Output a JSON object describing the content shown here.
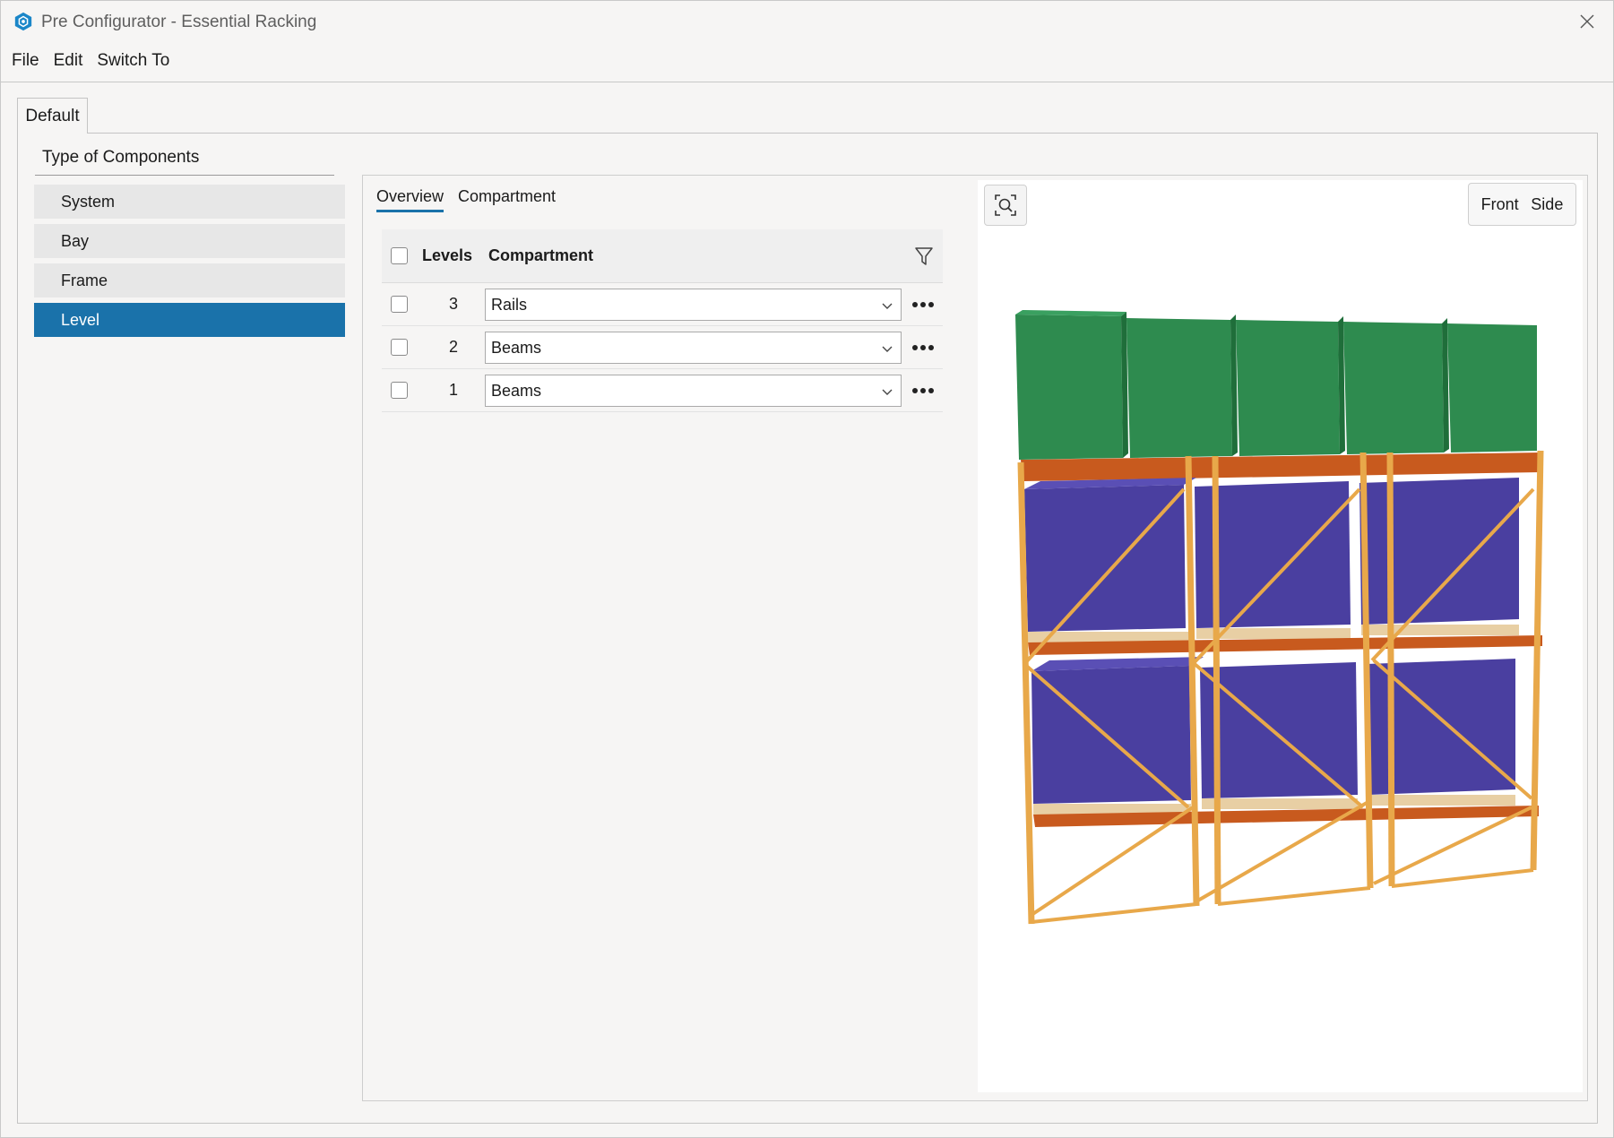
{
  "window": {
    "title": "Pre Configurator - Essential Racking"
  },
  "menu": {
    "items": [
      "File",
      "Edit",
      "Switch To"
    ]
  },
  "outer_tab": {
    "label": "Default"
  },
  "type_of_components": {
    "heading": "Type of Components",
    "items": [
      {
        "label": "System",
        "active": false
      },
      {
        "label": "Bay",
        "active": false
      },
      {
        "label": "Frame",
        "active": false
      },
      {
        "label": "Level",
        "active": true
      }
    ]
  },
  "sub_tabs": [
    {
      "label": "Overview",
      "active": true
    },
    {
      "label": "Compartment",
      "active": false
    }
  ],
  "table": {
    "headers": {
      "levels": "Levels",
      "compartment": "Compartment"
    },
    "rows": [
      {
        "level": "3",
        "compartment": "Rails"
      },
      {
        "level": "2",
        "compartment": "Beams"
      },
      {
        "level": "1",
        "compartment": "Beams"
      }
    ]
  },
  "viewport": {
    "view_front": "Front",
    "view_side": "Side"
  },
  "colors": {
    "accent": "#1a72aa",
    "upright": "#e8a84a",
    "beam": "#c85a1e",
    "load_top": "#2e8b4f",
    "load_mid": "#4a3fa0"
  },
  "icons": {
    "app": "app-logo-icon",
    "close": "close-icon",
    "filter": "filter-icon",
    "zoom_fit": "zoom-fit-icon",
    "more": "more-options-icon",
    "dropdown": "chevron-down-icon"
  }
}
